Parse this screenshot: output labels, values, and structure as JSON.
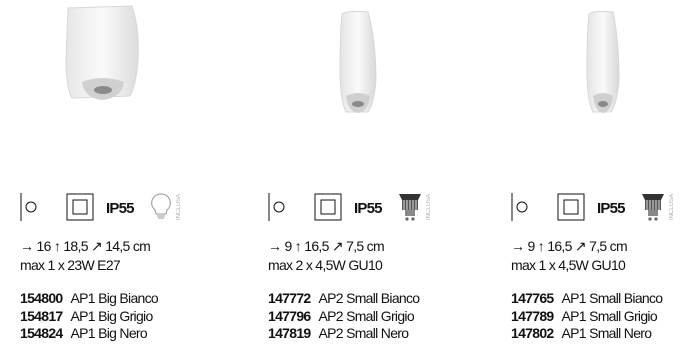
{
  "products": [
    {
      "ip": "IP55",
      "inclusa": "INCLUSA",
      "dims": "→ 16 ↑ 18,5 ↗ 14,5 cm",
      "max": "max 1 x 23W E27",
      "items": [
        {
          "code": "154800",
          "name": "AP1 Big Bianco"
        },
        {
          "code": "154817",
          "name": "AP1 Big Grigio"
        },
        {
          "code": "154824",
          "name": "AP1 Big Nero"
        }
      ]
    },
    {
      "ip": "IP55",
      "inclusa": "INCLUSA",
      "dims": "→ 9 ↑ 16,5 ↗ 7,5 cm",
      "max": "max 2 x 4,5W GU10",
      "items": [
        {
          "code": "147772",
          "name": "AP2 Small Bianco"
        },
        {
          "code": "147796",
          "name": "AP2 Small Grigio"
        },
        {
          "code": "147819",
          "name": "AP2 Small Nero"
        }
      ]
    },
    {
      "ip": "IP55",
      "inclusa": "INCLUSA",
      "dims": "→ 9 ↑ 16,5 ↗ 7,5 cm",
      "max": "max 1 x 4,5W GU10",
      "items": [
        {
          "code": "147765",
          "name": "AP1 Small Bianco"
        },
        {
          "code": "147789",
          "name": "AP1 Small Grigio"
        },
        {
          "code": "147802",
          "name": "AP1 Small Nero"
        }
      ]
    }
  ]
}
